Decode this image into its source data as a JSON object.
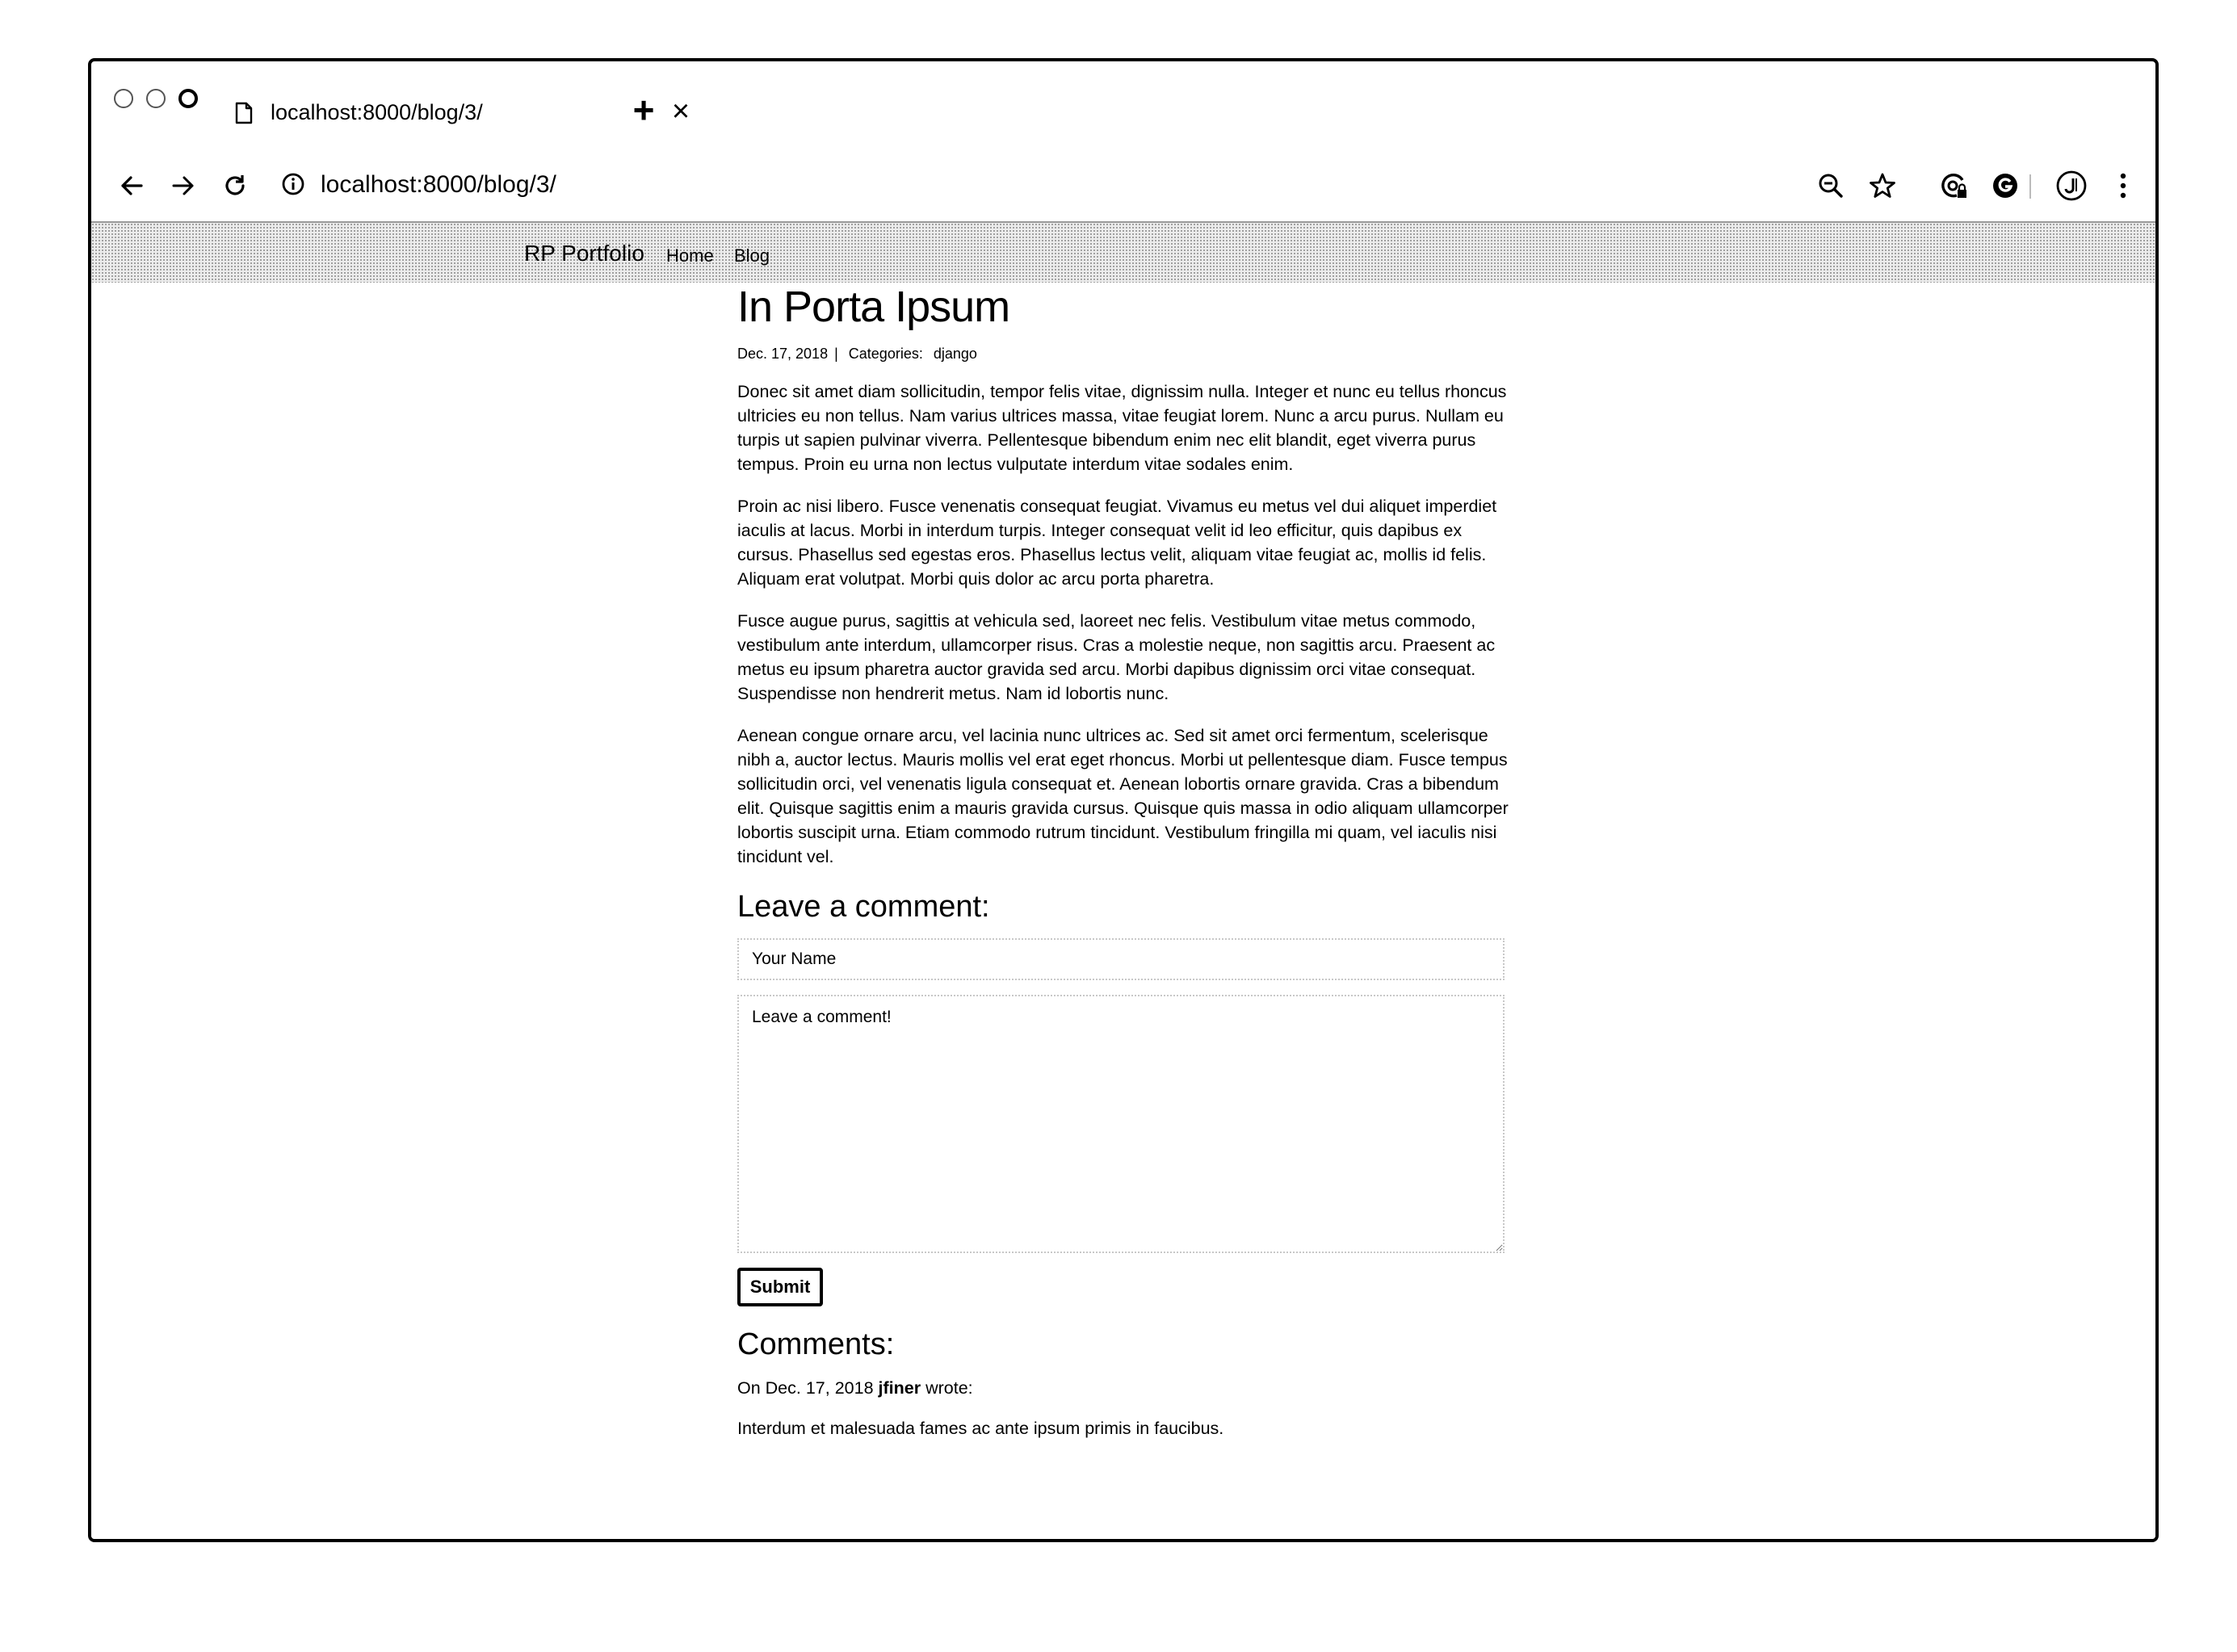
{
  "browser": {
    "tab_title": "localhost:8000/blog/3/",
    "tab_close": "×",
    "new_tab": "+",
    "url": "localhost:8000/blog/3/"
  },
  "navbar": {
    "brand": "RP Portfolio",
    "links": [
      "Home",
      "Blog"
    ]
  },
  "post": {
    "title": "In Porta Ipsum",
    "date": "Dec. 17, 2018",
    "meta_sep": "|",
    "categories_label": "Categories:",
    "category": "django",
    "paragraphs": [
      "Donec sit amet diam sollicitudin, tempor felis vitae, dignissim nulla. Integer et nunc eu tellus rhoncus ultricies eu non tellus. Nam varius ultrices massa, vitae feugiat lorem. Nunc a arcu purus. Nullam eu turpis ut sapien pulvinar viverra. Pellentesque bibendum enim nec elit blandit, eget viverra purus tempus. Proin eu urna non lectus vulputate interdum vitae sodales enim.",
      "Proin ac nisi libero. Fusce venenatis consequat feugiat. Vivamus eu metus vel dui aliquet imperdiet iaculis at lacus. Morbi in interdum turpis. Integer consequat velit id leo efficitur, quis dapibus ex cursus. Phasellus sed egestas eros. Phasellus lectus velit, aliquam vitae feugiat ac, mollis id felis. Aliquam erat volutpat. Morbi quis dolor ac arcu porta pharetra.",
      "Fusce augue purus, sagittis at vehicula sed, laoreet nec felis. Vestibulum vitae metus commodo, vestibulum ante interdum, ullamcorper risus. Cras a molestie neque, non sagittis arcu. Praesent ac metus eu ipsum pharetra auctor gravida sed arcu. Morbi dapibus dignissim orci vitae consequat. Suspendisse non hendrerit metus. Nam id lobortis nunc.",
      "Aenean congue ornare arcu, vel lacinia nunc ultrices ac. Sed sit amet orci fermentum, scelerisque nibh a, auctor lectus. Mauris mollis vel erat eget rhoncus. Morbi ut pellentesque diam. Fusce tempus sollicitudin orci, vel venenatis ligula consequat et. Aenean lobortis ornare gravida. Cras a bibendum elit. Quisque sagittis enim a mauris gravida cursus. Quisque quis massa in odio aliquam ullamcorper lobortis suscipit urna. Etiam commodo rutrum tincidunt. Vestibulum fringilla mi quam, vel iaculis nisi tincidunt vel."
    ]
  },
  "comment_form": {
    "heading": "Leave a comment:",
    "name_placeholder": "Your Name",
    "comment_placeholder": "Leave a comment!",
    "submit_label": "Submit"
  },
  "comments": {
    "heading": "Comments:",
    "items": [
      {
        "prefix": "On Dec. 17, 2018",
        "author": "jfiner",
        "suffix": "wrote:",
        "body": "Interdum et malesuada fames ac ante ipsum primis in faucibus."
      }
    ]
  },
  "icons": {
    "tab": "document-icon",
    "back": "back-arrow-icon",
    "forward": "forward-arrow-icon",
    "reload": "reload-icon",
    "info": "info-icon",
    "zoom": "zoom-out-icon",
    "bookmark": "star-icon",
    "extension1": "extension-lock-icon",
    "extension2": "extension-g-icon",
    "profile": "profile-avatar-icon",
    "menu": "kebab-menu-icon"
  }
}
